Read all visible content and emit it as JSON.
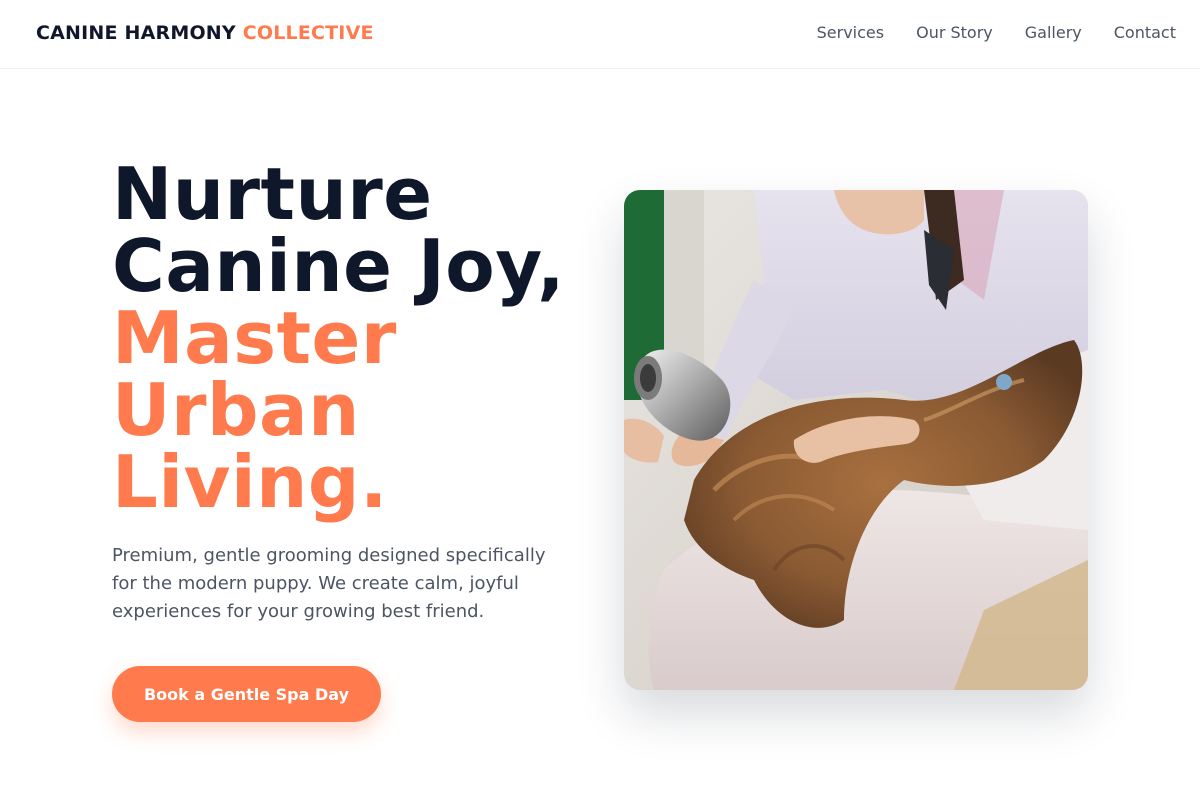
{
  "header": {
    "brand_primary": "CANINE HARMONY",
    "brand_accent": "COLLECTIVE",
    "nav": [
      "Services",
      "Our Story",
      "Gallery",
      "Contact"
    ]
  },
  "hero": {
    "title_line1": "Nurture",
    "title_line2": "Canine Joy,",
    "title_line3": "Master",
    "title_line4": "Urban",
    "title_line5": "Living.",
    "subtitle": "Premium, gentle grooming designed specifically for the modern puppy. We create calm, joyful experiences for your growing best friend.",
    "cta_label": "Book a Gentle Spa Day",
    "image_alt": "Groomer blow-drying a long-haired dog on a towel"
  },
  "colors": {
    "accent": "#ff7a4d",
    "heading": "#0f172a",
    "body_text": "#4b5563"
  }
}
